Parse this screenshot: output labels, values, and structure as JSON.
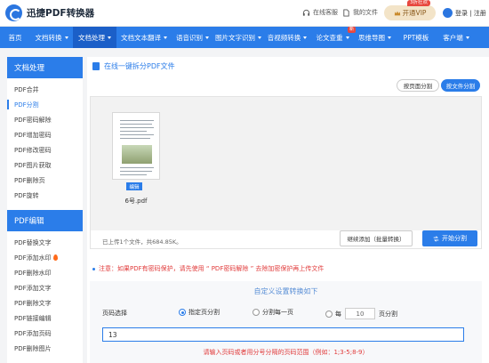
{
  "header": {
    "logo_text": "迅捷PDF转换器",
    "customer_service": "在线客服",
    "my_files": "我的文件",
    "vip_label": "开通VIP",
    "vip_badge": "3折狂欢",
    "login": "登录 | 注册"
  },
  "nav": {
    "items": [
      {
        "label": "首页"
      },
      {
        "label": "文档转换"
      },
      {
        "label": "文档处理"
      },
      {
        "label": "文档文本翻译"
      },
      {
        "label": "语音识别"
      },
      {
        "label": "图片文字识别"
      },
      {
        "label": "音视频转换"
      },
      {
        "label": "论文查重",
        "badge": "新"
      },
      {
        "label": "思维导图"
      },
      {
        "label": "PPT模板"
      },
      {
        "label": "客户端"
      }
    ]
  },
  "sidebar": {
    "section1_title": "文档处理",
    "section1_items": [
      "PDF合并",
      "PDF分割",
      "PDF密码解除",
      "PDF增加密码",
      "PDF修改密码",
      "PDF图片获取",
      "PDF删除页",
      "PDF旋转"
    ],
    "section2_title": "PDF编辑",
    "section2_items": [
      "PDF替换文字",
      "PDF添加水印",
      "PDF删除水印",
      "PDF添加文字",
      "PDF删除文字",
      "PDF链接编辑",
      "PDF添加页码",
      "PDF删除图片"
    ]
  },
  "main": {
    "title": "在线一键拆分PDF文件",
    "tab_by_page": "按页面分割",
    "tab_by_file": "按文件分割",
    "file_edit_tag": "编辑",
    "file_name": "6号.pdf",
    "upload_status": "已上传1个文件，共684.85K。",
    "continue_button": "继续添加（批量转换）",
    "start_button": "开始分割",
    "note": "注意：如果PDF有密码保护，请先使用 “ PDF密码解除 ” 去除加密保护再上传文件",
    "settings_title": "自定义设置转换如下",
    "page_select_label": "页码选择",
    "option_specified": "指定页分割",
    "option_each": "分割每一页",
    "option_every_prefix": "每",
    "option_every_value": "10",
    "option_every_suffix": "页分割",
    "pages_input_value": "13",
    "hint": "请输入页码或者用分号分隔的页码范围（例如：1;3-5;8-9）"
  },
  "colors": {
    "primary": "#2b7de9",
    "nav_active": "#1b5fc8",
    "warning": "#e13c3c"
  }
}
